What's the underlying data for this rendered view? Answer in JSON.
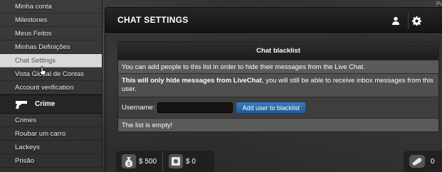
{
  "sidebar": {
    "items_top": [
      {
        "label": "Minha conta"
      },
      {
        "label": "Milestones"
      },
      {
        "label": "Meus Feitos"
      },
      {
        "label": "Minhas Definições"
      },
      {
        "label": "Chat Settings"
      },
      {
        "label": "Vista Global de Contas"
      },
      {
        "label": "Account verification"
      }
    ],
    "section": {
      "label": "Crime",
      "icon": "gun-icon"
    },
    "items_crime": [
      {
        "label": "Crimes"
      },
      {
        "label": "Roubar um carro"
      },
      {
        "label": "Lackeys"
      },
      {
        "label": "Prisão"
      }
    ]
  },
  "panel": {
    "title": "CHAT SETTINGS",
    "corner_text": "Po",
    "icons": [
      "user-icon",
      "gear-icon"
    ]
  },
  "blacklist": {
    "heading": "Chat blacklist",
    "intro": "You can add people to this list in order to hide their messages from the Live Chat.",
    "warning_bold": "This will only hide messages from LiveChat",
    "warning_rest": ", you will still be able to receive inbox messages from this user.",
    "username_label": "Username:",
    "username_value": "",
    "add_button": "Add user to blacklist",
    "empty_text": "The list is empty!"
  },
  "stats": {
    "cash": "$ 500",
    "bank": "$ 0",
    "right_value": "0"
  },
  "colors": {
    "accent_button": "#2d6ca8",
    "active_item_bg": "#d9d9d9"
  }
}
